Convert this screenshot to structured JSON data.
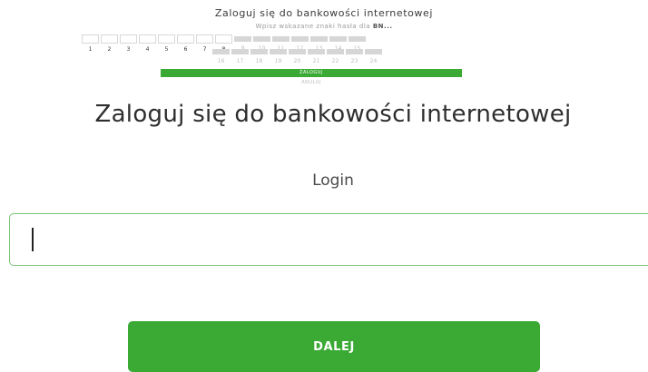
{
  "preview": {
    "title": "Zaloguj się do bankowości internetowej",
    "instruction": "Wpisz wskazane znaki hasła dla",
    "instruction_bold": "BN...",
    "row1": [
      {
        "n": "1",
        "filled": false
      },
      {
        "n": "2",
        "filled": false
      },
      {
        "n": "3",
        "filled": false
      },
      {
        "n": "4",
        "filled": false
      },
      {
        "n": "5",
        "filled": false
      },
      {
        "n": "6",
        "filled": false
      },
      {
        "n": "7",
        "filled": false
      },
      {
        "n": "8",
        "filled": false
      },
      {
        "n": "9",
        "filled": true
      },
      {
        "n": "10",
        "filled": true
      },
      {
        "n": "11",
        "filled": true
      },
      {
        "n": "12",
        "filled": true
      },
      {
        "n": "13",
        "filled": true
      },
      {
        "n": "14",
        "filled": true
      },
      {
        "n": "15",
        "filled": true
      }
    ],
    "row2": [
      {
        "n": "16",
        "filled": true
      },
      {
        "n": "17",
        "filled": true
      },
      {
        "n": "18",
        "filled": true
      },
      {
        "n": "19",
        "filled": true
      },
      {
        "n": "20",
        "filled": true
      },
      {
        "n": "21",
        "filled": true
      },
      {
        "n": "22",
        "filled": true
      },
      {
        "n": "23",
        "filled": true
      },
      {
        "n": "24",
        "filled": true
      }
    ],
    "login_button": "ZALOGUJ",
    "cancel_link": "ANULUJ"
  },
  "main": {
    "title": "Zaloguj się do bankowości internetowej",
    "login_label": "Login",
    "login_value": "",
    "next_button": "DALEJ"
  },
  "colors": {
    "accent": "#3aaa35",
    "input_border": "#7cc47a"
  }
}
